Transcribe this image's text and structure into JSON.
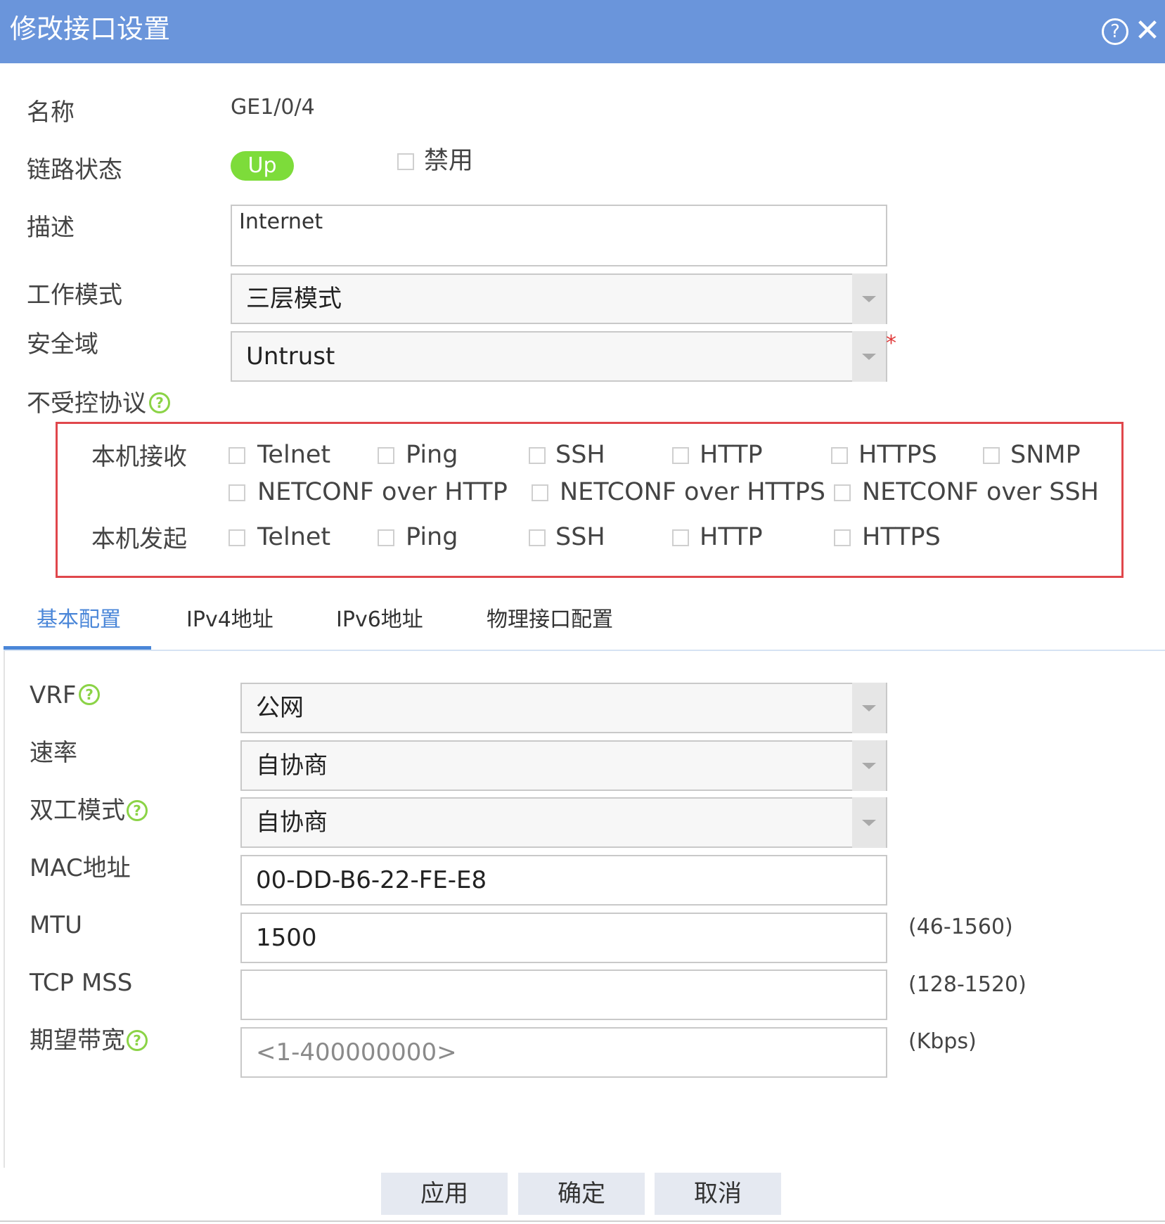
{
  "dialog": {
    "title": "修改接口设置",
    "help_icon": "question-circle-icon",
    "close_icon": "close-icon"
  },
  "form": {
    "name_label": "名称",
    "name_value": "GE1/0/4",
    "link_status_label": "链路状态",
    "link_status_value": "Up",
    "link_status_color": "#7ddc3a",
    "disable_label": "禁用",
    "description_label": "描述",
    "description_value": "Internet",
    "work_mode_label": "工作模式",
    "work_mode_value": "三层模式",
    "security_zone_label": "安全域",
    "security_zone_value": "Untrust",
    "required_mark": "*",
    "uncontrolled_protocols_label": "不受控协议"
  },
  "protocols": {
    "local_receive_label": "本机接收",
    "local_receive": [
      "Telnet",
      "Ping",
      "SSH",
      "HTTP",
      "HTTPS",
      "SNMP",
      "NETCONF over HTTP",
      "NETCONF over HTTPS",
      "NETCONF over SSH"
    ],
    "local_initiate_label": "本机发起",
    "local_initiate": [
      "Telnet",
      "Ping",
      "SSH",
      "HTTP",
      "HTTPS"
    ],
    "border_color": "#e0474c"
  },
  "tabs": {
    "basic": "基本配置",
    "ipv4": "IPv4地址",
    "ipv6": "IPv6地址",
    "physical": "物理接口配置",
    "active_color": "#4a86d8"
  },
  "basic": {
    "vrf_label": "VRF",
    "vrf_value": "公网",
    "rate_label": "速率",
    "rate_value": "自协商",
    "duplex_label": "双工模式",
    "duplex_value": "自协商",
    "mac_label": "MAC地址",
    "mac_value": "00-DD-B6-22-FE-E8",
    "mtu_label": "MTU",
    "mtu_value": "1500",
    "mtu_hint": "(46-1560)",
    "tcp_mss_label": "TCP MSS",
    "tcp_mss_value": "",
    "tcp_mss_hint": "(128-1520)",
    "bandwidth_label": "期望带宽",
    "bandwidth_placeholder": "<1-400000000>",
    "bandwidth_hint": "(Kbps)"
  },
  "buttons": {
    "apply": "应用",
    "ok": "确定",
    "cancel": "取消"
  },
  "colors": {
    "title_bar": "#6a95db",
    "help_icon": "#8bd346"
  }
}
